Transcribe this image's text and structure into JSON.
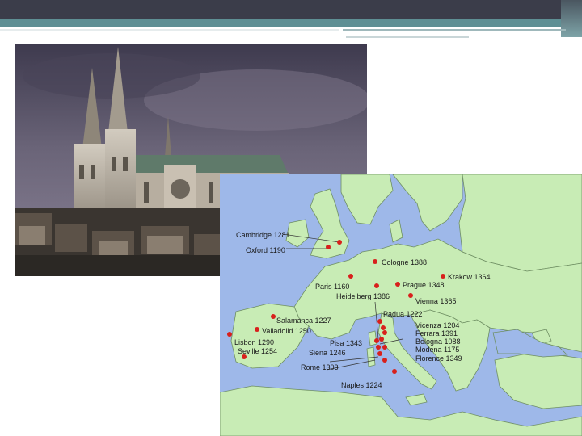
{
  "slide": {
    "colors": {
      "header": "#3b3d4a",
      "accent": "#5e8f94",
      "map_sea": "#9eb8e9",
      "map_land": "#c8ecb5",
      "city_dot": "#d8201c"
    }
  },
  "photo": {
    "subject": "cathedral"
  },
  "map": {
    "cities": [
      {
        "label": "Cambridge 1281"
      },
      {
        "label": "Oxford 1190"
      },
      {
        "label": "Cologne 1388"
      },
      {
        "label": "Krakow 1364"
      },
      {
        "label": "Paris 1160"
      },
      {
        "label": "Prague 1348"
      },
      {
        "label": "Heidelberg 1386"
      },
      {
        "label": "Vienna 1365"
      },
      {
        "label": "Padua 1222"
      },
      {
        "label": "Salamanca 1227"
      },
      {
        "label": "Valladolid 1250"
      },
      {
        "label": "Vicenza 1204"
      },
      {
        "label": "Ferrara 1391"
      },
      {
        "label": "Lisbon 1290"
      },
      {
        "label": "Pisa 1343"
      },
      {
        "label": "Bologna 1088"
      },
      {
        "label": "Seville 1254"
      },
      {
        "label": "Siena 1246"
      },
      {
        "label": "Modena 1175"
      },
      {
        "label": "Florence 1349"
      },
      {
        "label": "Rome 1303"
      },
      {
        "label": "Naples 1224"
      }
    ]
  }
}
